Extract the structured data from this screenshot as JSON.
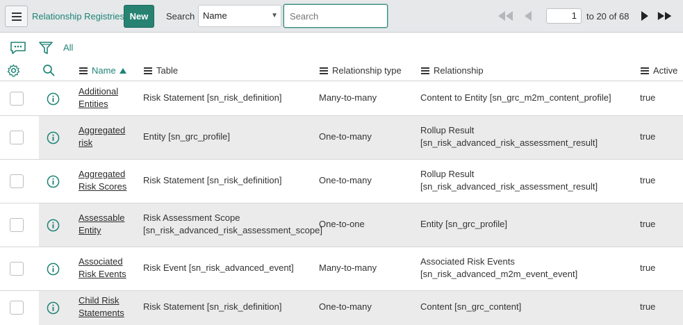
{
  "header": {
    "menu_icon": "hamburger-icon",
    "title": "Relationship Registries",
    "new_label": "New",
    "search_label": "Search",
    "search_field": "Name",
    "search_placeholder": "Search",
    "page_current": "1",
    "page_range": "to 20 of 68",
    "accent": "#278272"
  },
  "toolbar": {
    "all_label": "All"
  },
  "columns": {
    "name": "Name",
    "table": "Table",
    "relationship_type": "Relationship type",
    "relationship": "Relationship",
    "active": "Active"
  },
  "rows": [
    {
      "name_l1": "Additional",
      "name_l2": "Entities",
      "table_l1": "Risk Statement [sn_risk_definition]",
      "table_l2": "",
      "type": "Many-to-many",
      "rel_l1": "Content to Entity [sn_grc_m2m_content_profile]",
      "rel_l2": "",
      "active": "true"
    },
    {
      "name_l1": "Aggregated",
      "name_l2": "risk",
      "table_l1": "Entity [sn_grc_profile]",
      "table_l2": "",
      "type": "One-to-many",
      "rel_l1": "Rollup Result",
      "rel_l2": "[sn_risk_advanced_risk_assessment_result]",
      "active": "true"
    },
    {
      "name_l1": "Aggregated",
      "name_l2": "Risk Scores",
      "table_l1": "Risk Statement [sn_risk_definition]",
      "table_l2": "",
      "type": "One-to-many",
      "rel_l1": "Rollup Result",
      "rel_l2": "[sn_risk_advanced_risk_assessment_result]",
      "active": "true"
    },
    {
      "name_l1": "Assessable",
      "name_l2": "Entity",
      "table_l1": "Risk Assessment Scope",
      "table_l2": "[sn_risk_advanced_risk_assessment_scope]",
      "type": "One-to-one",
      "rel_l1": "Entity [sn_grc_profile]",
      "rel_l2": "",
      "active": "true"
    },
    {
      "name_l1": "Associated",
      "name_l2": "Risk Events",
      "table_l1": "Risk Event [sn_risk_advanced_event]",
      "table_l2": "",
      "type": "Many-to-many",
      "rel_l1": "Associated Risk Events",
      "rel_l2": "[sn_risk_advanced_m2m_event_event]",
      "active": "true"
    },
    {
      "name_l1": "Child Risk",
      "name_l2": "Statements",
      "table_l1": "Risk Statement [sn_risk_definition]",
      "table_l2": "",
      "type": "One-to-many",
      "rel_l1": "Content [sn_grc_content]",
      "rel_l2": "",
      "active": "true"
    }
  ]
}
